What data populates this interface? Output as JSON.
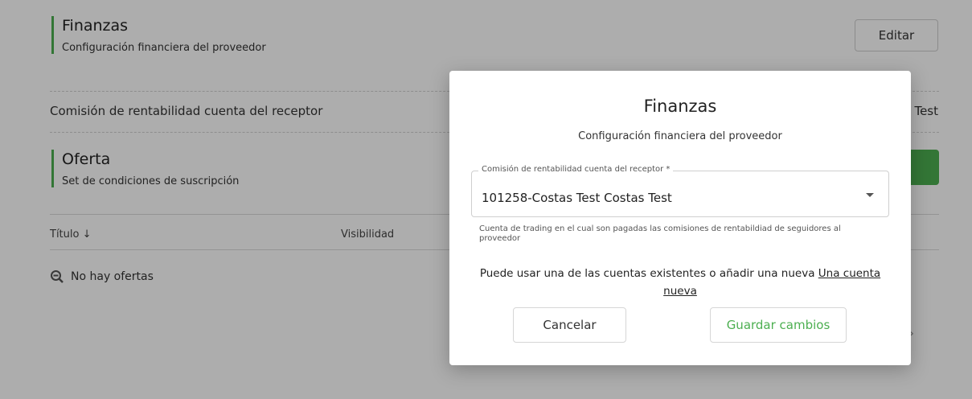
{
  "finanzas": {
    "title": "Finanzas",
    "subtitle": "Configuración financiera del proveedor",
    "edit_label": "Editar",
    "row_label": "Comisión de rentabilidad cuenta del receptor",
    "row_value": "Test"
  },
  "oferta": {
    "title": "Oferta",
    "subtitle": "Set de condiciones de suscripción",
    "columns": [
      "Título ↓",
      "Visibilidad"
    ],
    "empty_text": "No hay ofertas"
  },
  "modal": {
    "title": "Finanzas",
    "subtitle": "Configuración financiera del proveedor",
    "field_label": "Comisión de rentabilidad cuenta del receptor *",
    "field_value": "101258-Costas Test Costas Test",
    "helper_text": "Cuenta de trading en el cual son pagadas las comisiones de rentabildiad de seguidores al proveedor",
    "info_text": "Puede usar una de las cuentas existentes o añadir una nueva ",
    "link_text": "Una cuenta nueva",
    "cancel_label": "Cancelar",
    "save_label": "Guardar cambios"
  },
  "colors": {
    "accent": "#4caf50",
    "overlay": "rgba(0,0,0,0.32)"
  }
}
